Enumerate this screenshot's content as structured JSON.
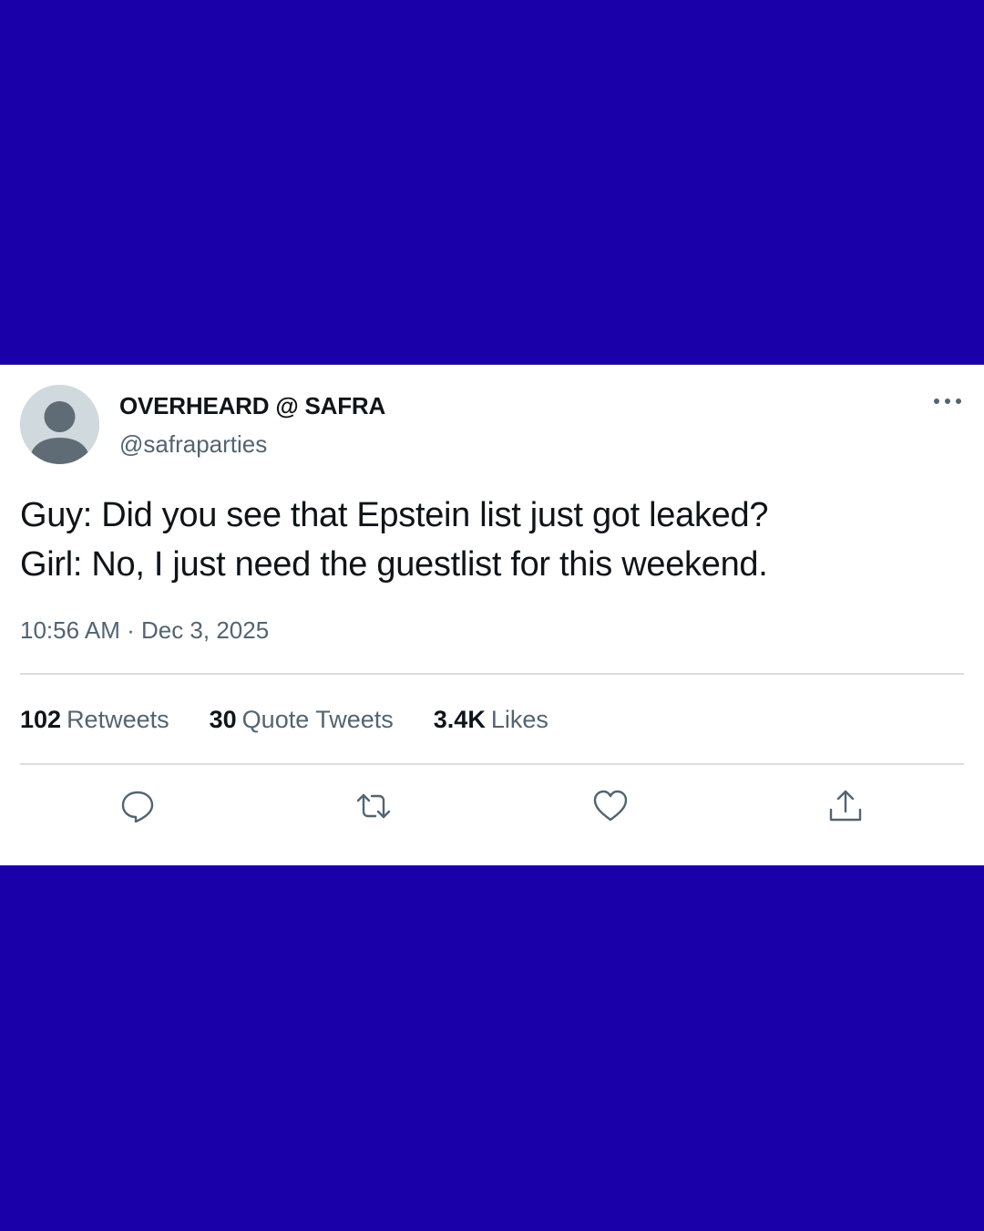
{
  "colors": {
    "background": "#1a00a8",
    "card": "#ffffff",
    "text_primary": "#0f1419",
    "text_secondary": "#536471",
    "divider": "#d9dee2"
  },
  "tweet": {
    "display_name": "OVERHEARD @ SAFRA",
    "handle": "@safraparties",
    "text_lines": [
      "Guy: Did you see that Epstein list just got leaked?",
      "Girl: No, I just need the guestlist for this weekend."
    ],
    "timestamp": "10:56 AM · Dec 3, 2025",
    "stats": {
      "retweets": {
        "count": "102",
        "label": "Retweets"
      },
      "quote_tweets": {
        "count": "30",
        "label": "Quote Tweets"
      },
      "likes": {
        "count": "3.4K",
        "label": "Likes"
      }
    },
    "icons": {
      "avatar": "default-avatar-icon",
      "more": "more-options-icon",
      "reply": "reply-icon",
      "retweet": "retweet-icon",
      "like": "heart-icon",
      "share": "share-icon"
    }
  }
}
